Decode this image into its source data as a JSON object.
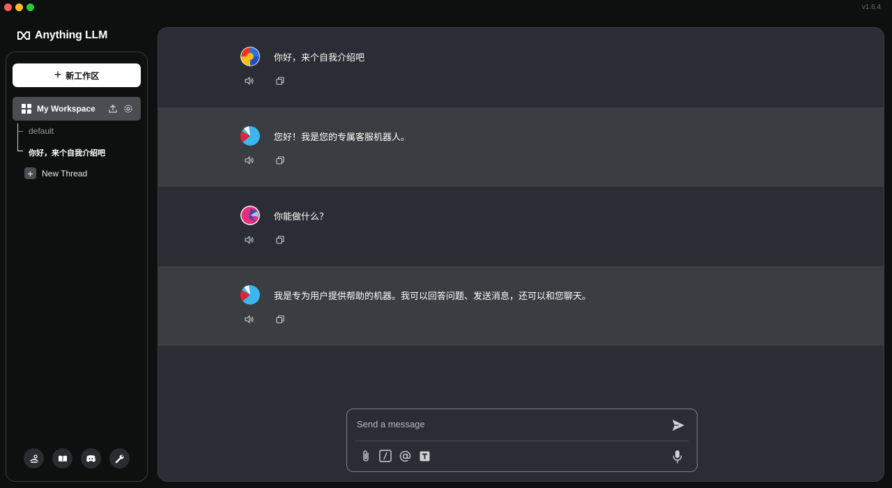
{
  "app": {
    "version": "v1.6.4",
    "logo_text": "Anything LLM"
  },
  "sidebar": {
    "new_workspace_label": "新工作区",
    "workspace": {
      "name": "My Workspace"
    },
    "threads": [
      {
        "label": "default"
      },
      {
        "label": "你好，来个自我介绍吧"
      }
    ],
    "new_thread_label": "New Thread",
    "footer_icons": [
      "community-hub-icon",
      "docs-book-icon",
      "discord-icon",
      "settings-wrench-icon"
    ]
  },
  "chat": {
    "messages": [
      {
        "role": "user",
        "text": "你好，来个自我介绍吧"
      },
      {
        "role": "assistant",
        "text": "您好！我是您的专属客服机器人。"
      },
      {
        "role": "user",
        "text": "你能做什么？"
      },
      {
        "role": "assistant",
        "text": "我是专为用户提供帮助的机器。我可以回答问题、发送消息，还可以和您聊天。"
      }
    ]
  },
  "composer": {
    "placeholder": "Send a message",
    "value": ""
  },
  "colors": {
    "background": "#0e0f0f",
    "panel": "#2a2d33",
    "assistant_row": "#3a3d42",
    "accent_white": "#ffffff"
  }
}
